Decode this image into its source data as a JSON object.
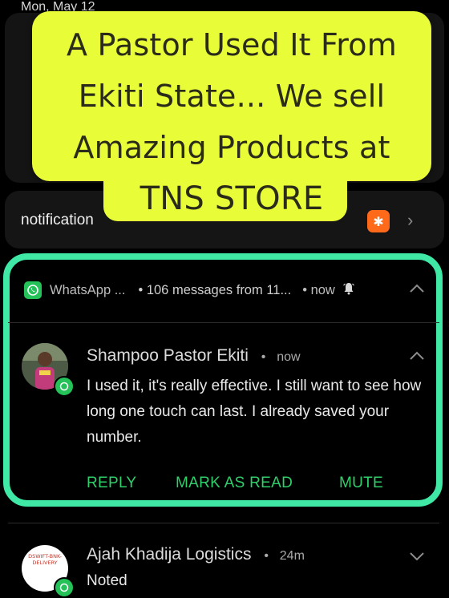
{
  "status": {
    "date": "Mon, May 12"
  },
  "top_notification": {
    "text": "notification",
    "app_icon": "uc-browser-icon"
  },
  "banner": {
    "lines": [
      "A Pastor Used It From",
      "Ekiti State... We sell",
      "Amazing Products at",
      "TNS STORE"
    ]
  },
  "whatsapp": {
    "app_name": "WhatsApp ...",
    "summary": "• 106 messages from 11...",
    "time": "• now",
    "bell_icon": "bell-icon",
    "message": {
      "sender": "Shampoo Pastor Ekiti",
      "time": "now",
      "body": "I used it, it's really effective. I still want to see how long one touch can last. I already saved your number."
    },
    "actions": {
      "reply": "REPLY",
      "mark_read": "MARK AS READ",
      "mute": "MUTE"
    },
    "accent": "#3fe8a5",
    "action_color": "#2fcf6b"
  },
  "next_message": {
    "sender": "Ajah Khadija Logistics",
    "time": "24m",
    "body": "Noted",
    "avatar_text": "DSWIFT-BNK- DELIVERY"
  }
}
